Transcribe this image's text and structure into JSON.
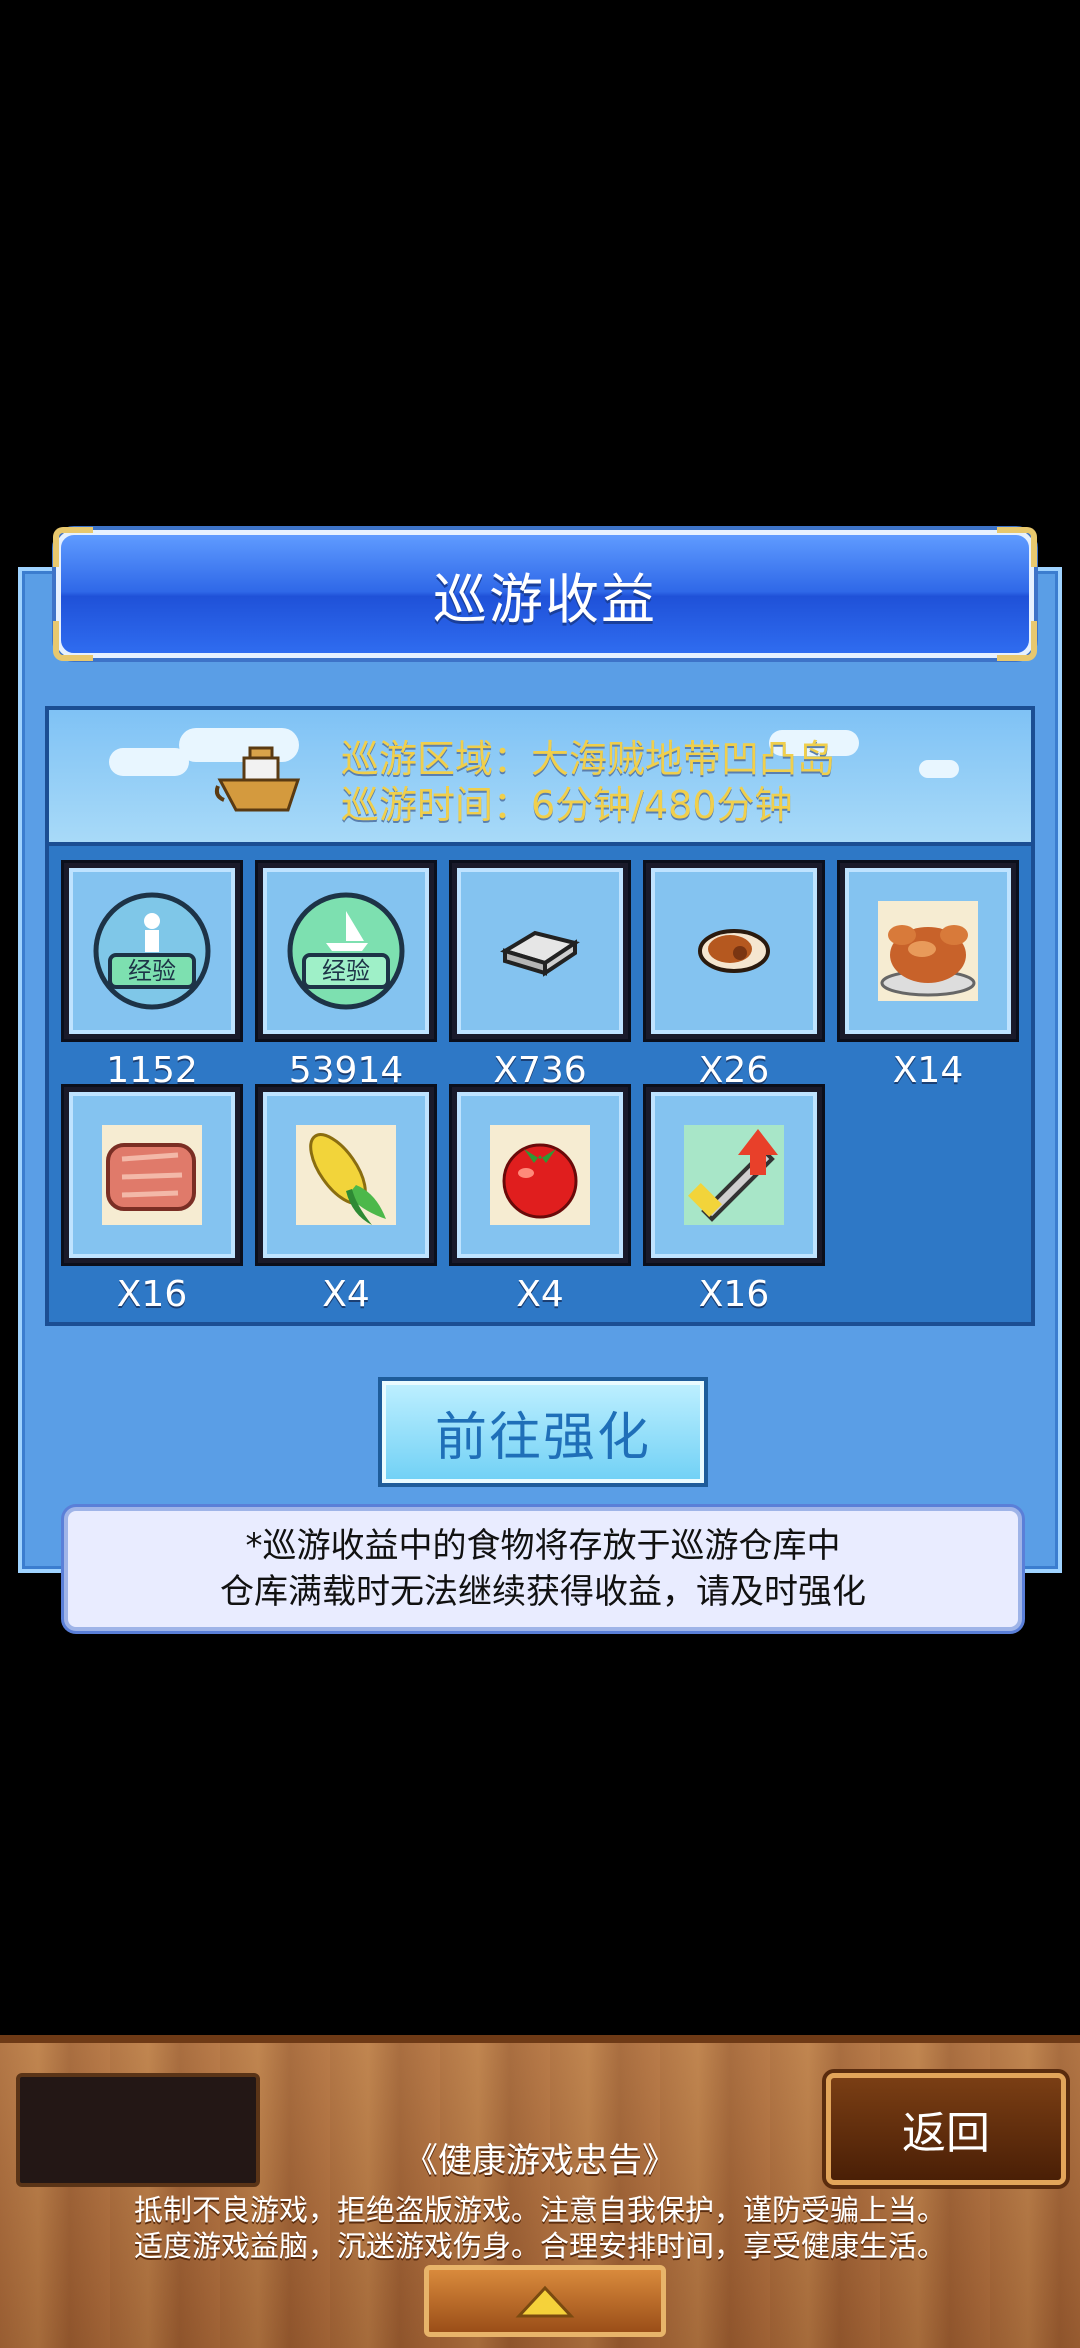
{
  "dialog": {
    "title": "巡游收益",
    "cruise_area": "巡游区域：大海贼地带凹凸岛",
    "cruise_time": "巡游时间：6分钟/480分钟",
    "rewards": [
      {
        "icon": "person-exp-icon",
        "label": "1152"
      },
      {
        "icon": "ship-exp-icon",
        "label": "53914"
      },
      {
        "icon": "silver-bar-icon",
        "label": "X736"
      },
      {
        "icon": "meat-chunk-icon",
        "label": "X26"
      },
      {
        "icon": "roast-chicken-icon",
        "label": "X14"
      },
      {
        "icon": "raw-meat-icon",
        "label": "X16"
      },
      {
        "icon": "corn-icon",
        "label": "X4"
      },
      {
        "icon": "tomato-icon",
        "label": "X4"
      },
      {
        "icon": "sword-upgrade-icon",
        "label": "X16"
      }
    ],
    "go_upgrade_label": "前往强化",
    "notice_line1": "*巡游收益中的食物将存放于巡游仓库中",
    "notice_line2": "仓库满载时无法继续获得收益，请及时强化"
  },
  "footer": {
    "back_label": "返回",
    "health_title": "《健康游戏忠告》",
    "health_line1": "抵制不良游戏，拒绝盗版游戏。注意自我保护，谨防受骗上当。",
    "health_line2": "适度游戏益脑，沉迷游戏伤身。合理安排时间，享受健康生活。"
  },
  "colors": {
    "accent_yellow": "#f0cf4c",
    "title_blue": "#2f68e8",
    "panel_blue": "#2e78c6"
  }
}
